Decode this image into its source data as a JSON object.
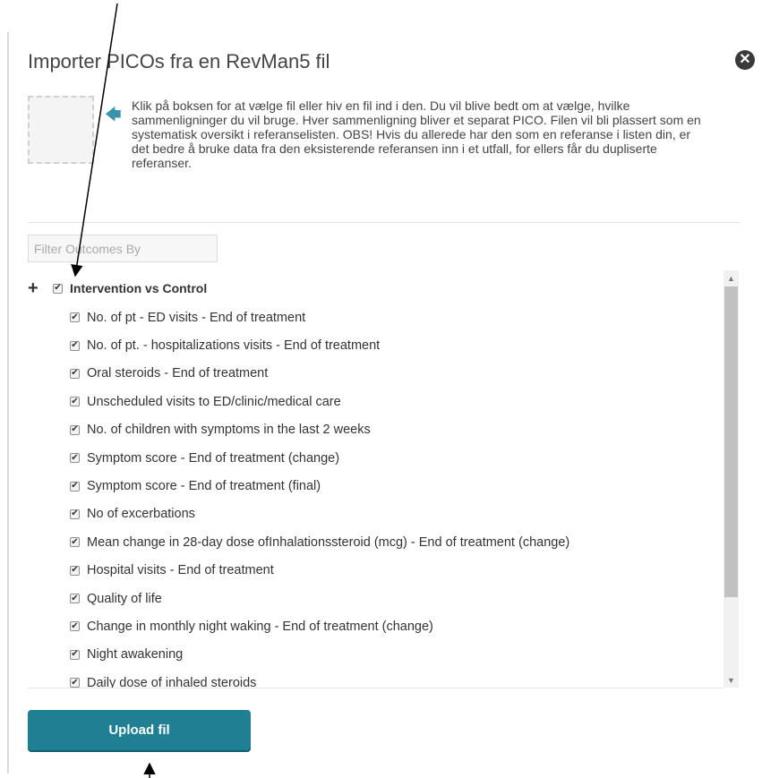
{
  "dialog": {
    "title": "Importer PICOs fra en RevMan5 fil",
    "close_icon": "close-circle-icon",
    "instructions": "Klik på boksen for at vælge fil eller hiv en fil ind i den. Du vil blive bedt om at vælge, hvilke sammenligninger du vil bruge. Hver sammenligning bliver et separat PICO. Filen vil bli plassert som en systematisk oversikt i referanselisten. OBS! Hvis du allerede har den som en referanse i listen din, er det bedre å bruke data fra den eksisterende referansen inn i et utfall, for ellers får du dupliserte referanser."
  },
  "filter": {
    "placeholder": "Filter Outcomes By",
    "value": ""
  },
  "comparison": {
    "label": "Intervention vs Control",
    "checked": true,
    "outcomes": [
      "No. of pt - ED visits - End of treatment",
      "No. of pt. - hospitalizations visits - End of treatment",
      "Oral steroids - End of treatment",
      "Unscheduled visits to ED/clinic/medical care",
      "No. of children with symptoms in the last 2 weeks",
      "Symptom score - End of treatment (change)",
      "Symptom score - End of treatment (final)",
      "No of excerbations",
      "Mean change in 28-day dose ofInhalationssteroid (mcg) - End of treatment (change)",
      "Hospital visits - End of treatment",
      "Quality of life",
      "Change in monthly night waking - End of treatment (change)",
      "Night awakening",
      "Daily dose of inhaled steroids"
    ]
  },
  "upload_button": {
    "label": "Upload fil"
  },
  "colors": {
    "accent": "#1f7f93",
    "arrow_icon": "#3a93a8"
  }
}
